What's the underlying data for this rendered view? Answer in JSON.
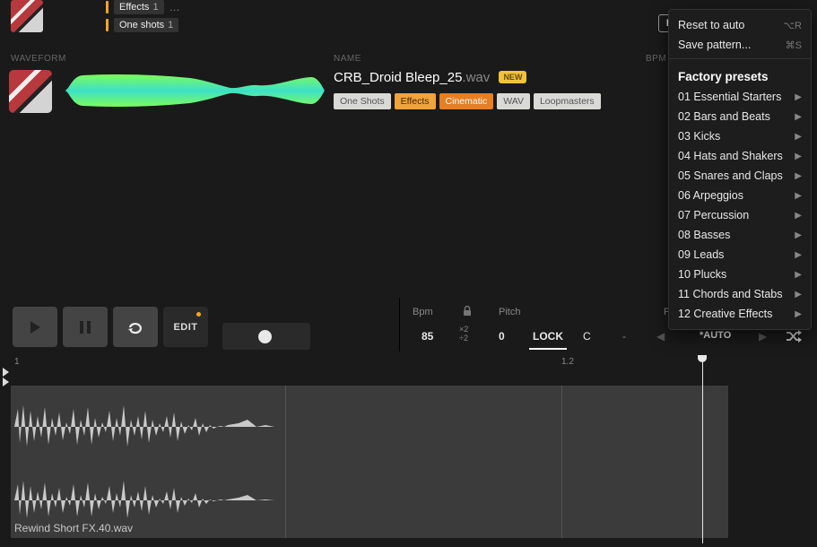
{
  "top_tags": {
    "row1": {
      "label": "Effects",
      "count": "1"
    },
    "row2": {
      "label": "One shots",
      "count": "1"
    }
  },
  "headers": {
    "waveform": "WAVEFORM",
    "name": "NAME",
    "bpm": "BPM"
  },
  "sample": {
    "name": "CRB_Droid Bleep_25",
    "ext": ".wav",
    "new": "NEW",
    "tags": {
      "t1": "One Shots",
      "t2": "Effects",
      "t3": "Cinematic",
      "t4": "WAV",
      "t5": "Loopmasters"
    }
  },
  "transport": {
    "edit": "EDIT",
    "labels": {
      "bpm": "Bpm",
      "pitch": "Pitch",
      "pattern": "Patt"
    },
    "values": {
      "bpm": "85",
      "mult_up": "×2",
      "mult_dn": "÷2",
      "pitch0": "0",
      "lock": "LOCK",
      "key": "C",
      "dash": "-",
      "auto": "*AUTO"
    }
  },
  "ruler": {
    "m1": "1",
    "m12": "1.2"
  },
  "edit_wave": {
    "filename": "Rewind Short FX.40.wav"
  },
  "menu_button": "M",
  "menu": {
    "reset": "Reset to auto",
    "reset_sc": "⌥R",
    "save": "Save pattern...",
    "save_sc": "⌘S",
    "header": "Factory presets",
    "items": {
      "i1": "01 Essential Starters",
      "i2": "02 Bars and Beats",
      "i3": "03 Kicks",
      "i4": "04 Hats and Shakers",
      "i5": "05 Snares and Claps",
      "i6": "06 Arpeggios",
      "i7": "07 Percussion",
      "i8": "08 Basses",
      "i9": "09 Leads",
      "i10": "10 Plucks",
      "i11": "11 Chords and Stabs",
      "i12": "12 Creative Effects"
    }
  }
}
